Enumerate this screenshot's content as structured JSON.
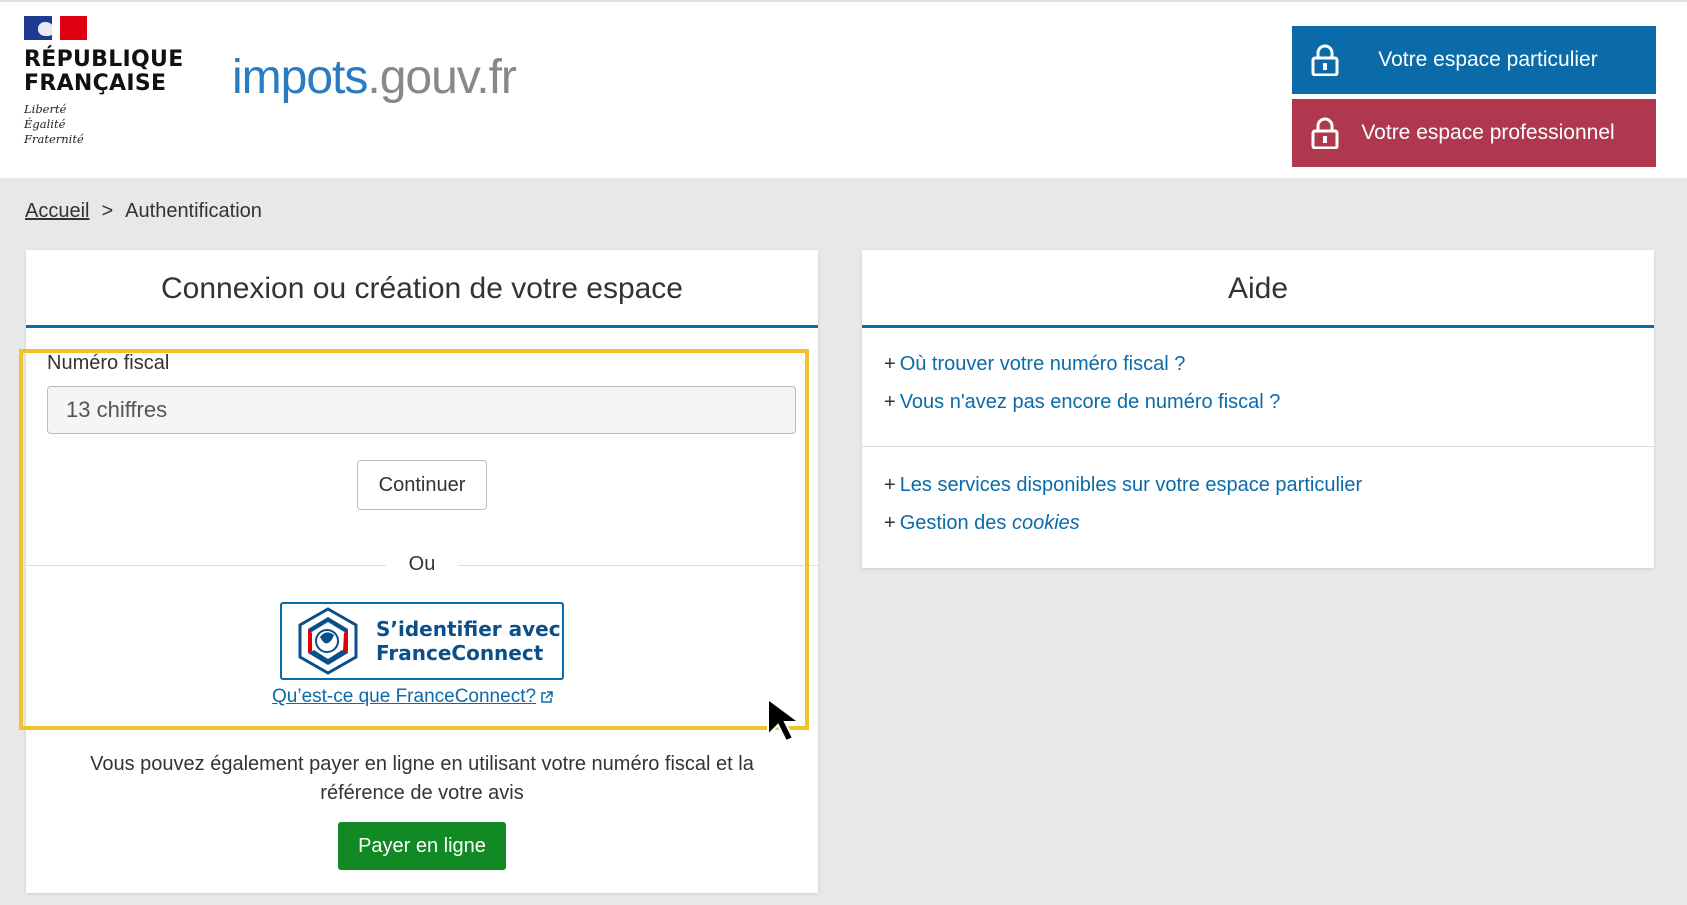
{
  "header": {
    "rf_line1": "RÉPUBLIQUE",
    "rf_line2": "FRANÇAISE",
    "rf_motto1": "Liberté",
    "rf_motto2": "Égalité",
    "rf_motto3": "Fraternité",
    "logo_part1": "impots",
    "logo_part2": ".gouv",
    "logo_part3": ".fr",
    "btn_particulier": "Votre espace particulier",
    "btn_professionnel": "Votre espace professionnel"
  },
  "breadcrumb": {
    "home": "Accueil",
    "separator": ">",
    "current": "Authentification"
  },
  "login": {
    "title": "Connexion ou création de votre espace",
    "field_label": "Numéro fiscal",
    "field_placeholder": "13 chiffres",
    "continue_label": "Continuer",
    "or_label": "Ou",
    "fc_line1": "S’identifier avec",
    "fc_line2": "FranceConnect",
    "fc_link": "Qu’est-ce que FranceConnect?",
    "info_text": "Vous pouvez également payer en ligne en utilisant votre numéro fiscal et la référence de votre avis",
    "pay_label": "Payer en ligne"
  },
  "aide": {
    "title": "Aide",
    "items": [
      {
        "label": "Où trouver votre numéro fiscal ?"
      },
      {
        "label": "Vous n'avez pas encore de numéro fiscal ?"
      }
    ],
    "items2": [
      {
        "label": "Les services disponibles sur votre espace particulier"
      },
      {
        "label_prefix": "Gestion des ",
        "label_em": "cookies"
      }
    ]
  },
  "colors": {
    "blue": "#0b6ba8",
    "red": "#b0384e",
    "green": "#118a25",
    "highlight": "#f2c12e"
  }
}
